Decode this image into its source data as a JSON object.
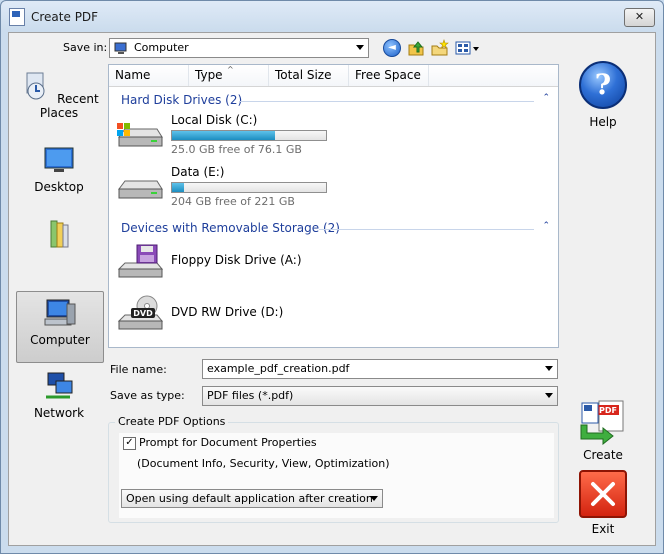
{
  "window": {
    "title": "Create PDF",
    "close_glyph": "✕"
  },
  "toolbar": {
    "save_in_label": "Save in:",
    "save_in_value": "Computer",
    "back_glyph": "◄"
  },
  "places": [
    {
      "label": "Recent Places",
      "icon": "recent-places-icon"
    },
    {
      "label": "Desktop",
      "icon": "desktop-icon"
    },
    {
      "label": "",
      "icon": "libraries-icon"
    },
    {
      "label": "Computer",
      "icon": "computer-icon",
      "selected": true
    },
    {
      "label": "Network",
      "icon": "network-icon"
    }
  ],
  "columns": [
    "Name",
    "Type",
    "Total Size",
    "Free Space"
  ],
  "sort_indicator": "^",
  "groups": {
    "hdd": {
      "label": "Hard Disk Drives (2)",
      "caret": "⌃"
    },
    "removable": {
      "label": "Devices with Removable Storage (2)",
      "caret": "⌃"
    }
  },
  "drives": [
    {
      "name": "Local Disk (C:)",
      "free_text": "25.0 GB free of 76.1 GB",
      "used_fraction": 0.67
    },
    {
      "name": "Data (E:)",
      "free_text": "204 GB free of 221 GB",
      "used_fraction": 0.08
    },
    {
      "name": "Floppy Disk Drive (A:)"
    },
    {
      "name": "DVD RW Drive (D:)",
      "badge": "DVD"
    }
  ],
  "form": {
    "file_name_label": "File name:",
    "file_name_value": "example_pdf_creation.pdf",
    "save_type_label": "Save as type:",
    "save_type_value": "PDF files (*.pdf)"
  },
  "options": {
    "title": "Create PDF Options",
    "prompt_label": "Prompt for Document Properties",
    "prompt_checked": true,
    "prompt_sub": "(Document Info, Security, View, Optimization)",
    "open_after": "Open using default application after creation"
  },
  "buttons": {
    "help": "Help",
    "help_glyph": "?",
    "create": "Create",
    "create_badge": "PDF",
    "exit": "Exit"
  },
  "colors": {
    "accent": "#1e3e9b",
    "drive_bar": "#1c8dc0"
  }
}
